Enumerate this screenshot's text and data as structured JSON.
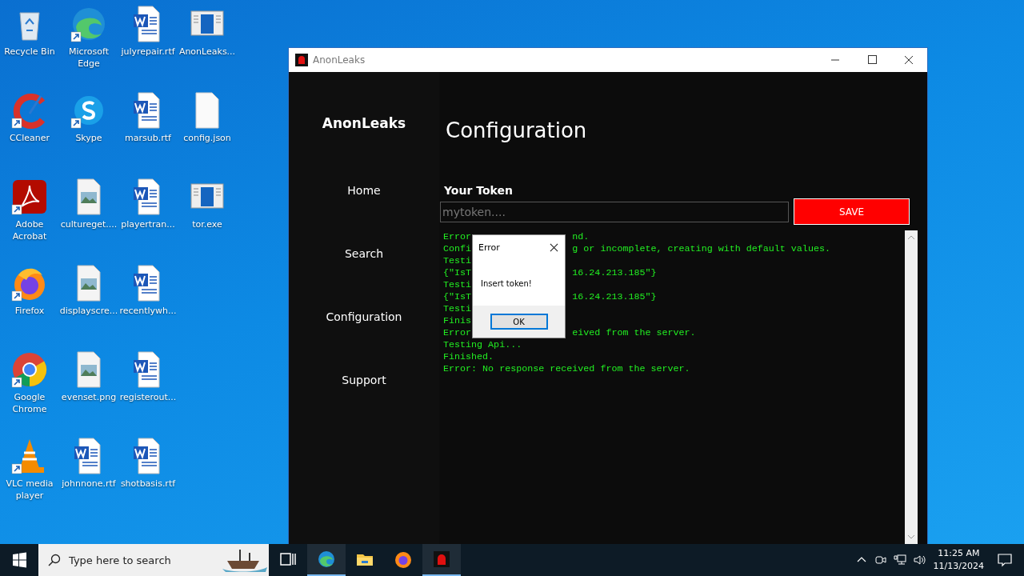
{
  "desktop_icons": [
    {
      "label": "Recycle Bin",
      "kind": "recycle",
      "shortcut": false
    },
    {
      "label": "CCleaner",
      "kind": "ccleaner",
      "shortcut": true
    },
    {
      "label": "Adobe Acrobat",
      "kind": "acrobat",
      "shortcut": true
    },
    {
      "label": "Firefox",
      "kind": "firefox",
      "shortcut": true
    },
    {
      "label": "Google Chrome",
      "kind": "chrome",
      "shortcut": true
    },
    {
      "label": "VLC media player",
      "kind": "vlc",
      "shortcut": true
    },
    {
      "label": "Microsoft Edge",
      "kind": "edge",
      "shortcut": true
    },
    {
      "label": "Skype",
      "kind": "skype",
      "shortcut": true
    },
    {
      "label": "cultureget....",
      "kind": "image",
      "shortcut": false
    },
    {
      "label": "displayscre...",
      "kind": "image",
      "shortcut": false
    },
    {
      "label": "evenset.png",
      "kind": "image",
      "shortcut": false
    },
    {
      "label": "johnnone.rtf",
      "kind": "word",
      "shortcut": false
    },
    {
      "label": "julyrepair.rtf",
      "kind": "word",
      "shortcut": false
    },
    {
      "label": "marsub.rtf",
      "kind": "word",
      "shortcut": false
    },
    {
      "label": "playertran...",
      "kind": "word",
      "shortcut": false
    },
    {
      "label": "recentlywh...",
      "kind": "word",
      "shortcut": false
    },
    {
      "label": "registerout...",
      "kind": "word",
      "shortcut": false
    },
    {
      "label": "shotbasis.rtf",
      "kind": "word",
      "shortcut": false
    },
    {
      "label": "AnonLeaks...",
      "kind": "app",
      "shortcut": false
    },
    {
      "label": "config.json",
      "kind": "file",
      "shortcut": false
    },
    {
      "label": "tor.exe",
      "kind": "app",
      "shortcut": false
    }
  ],
  "window": {
    "title": "AnonLeaks",
    "sidebar": {
      "brand": "AnonLeaks",
      "items": [
        "Home",
        "Search",
        "Configuration",
        "Support"
      ]
    },
    "heading": "Configuration",
    "token_label": "Your Token",
    "token_field": {
      "placeholder": "mytoken...."
    },
    "save_button": "SAVE",
    "log": [
      {
        "head": "Error",
        "tail": "nd."
      },
      {
        "head": "Confi",
        "tail": "g or incomplete, creating with default values."
      },
      {
        "head": "Testi"
      },
      {
        "head": "{\"IsT",
        "tail": "16.24.213.185\"}"
      },
      {
        "head": "Testi"
      },
      {
        "head": "{\"IsT",
        "tail": "16.24.213.185\"}"
      },
      {
        "head": "Testi"
      },
      {
        "head": "Finis"
      },
      {
        "head": "Error",
        "tail": "eived from the server."
      },
      {
        "head": "Testing Api..."
      },
      {
        "head": "Finished."
      },
      {
        "head": "Error: No response received from the server."
      }
    ]
  },
  "dialog": {
    "title": "Error",
    "message": "Insert token!",
    "button": "OK"
  },
  "taskbar": {
    "search_placeholder": "Type here to search",
    "apps": [
      {
        "kind": "taskview",
        "running": false
      },
      {
        "kind": "edge",
        "running": true
      },
      {
        "kind": "folder",
        "running": false
      },
      {
        "kind": "firefox",
        "running": false
      },
      {
        "kind": "app",
        "running": true
      }
    ],
    "time": "11:25 AM",
    "date": "11/13/2024"
  }
}
